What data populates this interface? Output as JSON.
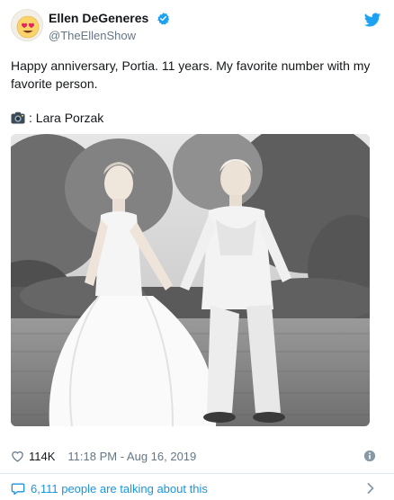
{
  "user": {
    "display_name": "Ellen DeGeneres",
    "handle": "@TheEllenShow",
    "avatar_icon": "heart-eyes-emoji-avatar",
    "verified_icon": "verified-badge-icon"
  },
  "tweet": {
    "text": "Happy anniversary, Portia. 11 years. My favorite number with my favorite person.",
    "credit_icon": "camera-icon",
    "credit_text": ": Lara Porzak"
  },
  "stats": {
    "likes": "114K",
    "timestamp": "11:18 PM - Aug 16, 2019"
  },
  "conversation": {
    "text": "6,111 people are talking about this"
  },
  "colors": {
    "brand_blue": "#1da1f2",
    "link_blue": "#1b95e0",
    "text_primary": "#14171a",
    "text_secondary": "#657786",
    "divider": "#e1e8ed"
  }
}
